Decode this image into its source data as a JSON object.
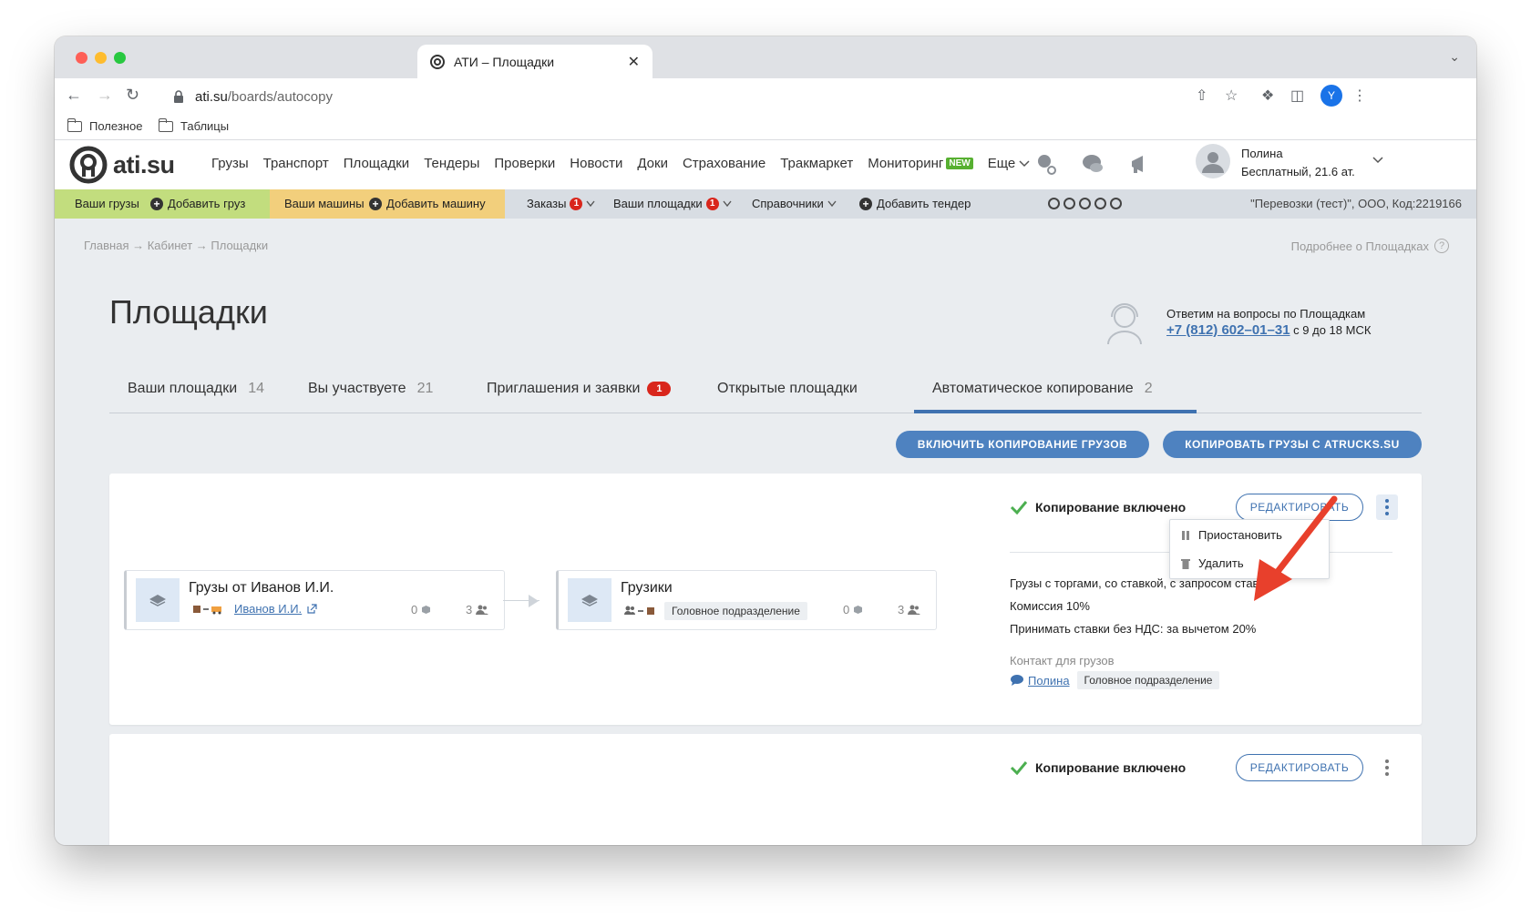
{
  "browser": {
    "tab_title": "АТИ – Площадки",
    "tab_close": "✕",
    "tab_expand": "⌄",
    "url_domain": "ati.su",
    "url_path": "/boards/autocopy",
    "profile_initial": "Y",
    "bookmarks": [
      "Полезное",
      "Таблицы"
    ]
  },
  "header": {
    "logo_text": "ati.su",
    "nav": [
      "Грузы",
      "Транспорт",
      "Площадки",
      "Тендеры",
      "Проверки",
      "Новости",
      "Доки",
      "Страхование",
      "Тракмаркет",
      "Мониторинг",
      "Еще"
    ],
    "new_badge": "NEW",
    "user_name": "Полина",
    "user_plan": "Бесплатный,  21.6 ат."
  },
  "subnav": {
    "your_cargo": "Ваши грузы",
    "add_cargo": "Добавить груз",
    "your_trucks": "Ваши машины",
    "add_truck": "Добавить машину",
    "orders": "Заказы",
    "orders_count": "1",
    "your_boards": "Ваши площадки",
    "boards_count": "1",
    "directories": "Справочники",
    "add_tender": "Добавить тендер",
    "company": "\"Перевозки (тест)\", ООО,  Код:2219166"
  },
  "page": {
    "breadcrumb": "Главная → Кабинет → Площадки",
    "more_info": "Подробнее о Площадках",
    "title": "Площадки",
    "support_title": "Ответим на вопросы по Площадкам",
    "support_phone": "+7 (812) 602–01–31",
    "support_hours": "с 9 до 18 МСК"
  },
  "tabs": [
    {
      "label": "Ваши площадки",
      "count": "14"
    },
    {
      "label": "Вы участвуете",
      "count": "21"
    },
    {
      "label": "Приглашения и заявки",
      "badge": "1"
    },
    {
      "label": "Открытые площадки"
    },
    {
      "label": "Автоматическое копирование",
      "count": "2"
    }
  ],
  "actions": {
    "enable_copy": "ВКЛЮЧИТЬ КОПИРОВАНИЕ ГРУЗОВ",
    "copy_from_atrucks": "КОПИРОВАТЬ ГРУЗЫ С ATRUCKS.SU"
  },
  "card1": {
    "status": "Копирование включено",
    "edit_label": "РЕДАКТИРОВАТЬ",
    "source": {
      "name": "Грузы от Иванов И.И.",
      "owner": "Иванов И.И.",
      "cargo_count": "0",
      "members_count": "3"
    },
    "target": {
      "name": "Грузики",
      "dept": "Головное подразделение",
      "cargo_count": "0",
      "members_count": "3"
    },
    "details": [
      "Грузы с торгами, со ставкой, с запросом ставки",
      "Комиссия 10%",
      "Принимать ставки без НДС: за вычетом 20%"
    ],
    "contact_label": "Контакт для грузов",
    "contact_name": "Полина",
    "contact_dept": "Головное подразделение",
    "menu": {
      "pause": "Приостановить",
      "delete": "Удалить"
    }
  },
  "card2": {
    "status": "Копирование включено",
    "edit_label": "РЕДАКТИРОВАТЬ"
  },
  "colors": {
    "accent": "#3f72b0",
    "annotation_arrow": "#e8402c"
  }
}
